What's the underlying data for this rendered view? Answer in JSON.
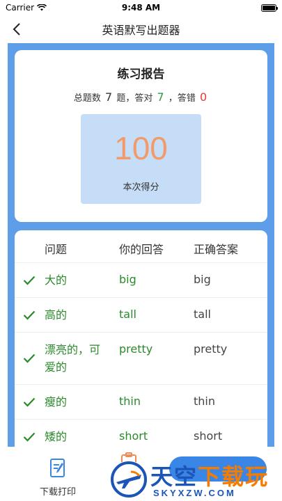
{
  "status_bar": {
    "carrier": "Carrier",
    "time": "9:48 AM"
  },
  "nav": {
    "title": "英语默写出题器"
  },
  "report": {
    "title": "练习报告",
    "total_prefix": "总题数",
    "total_count": "7",
    "total_suffix": "题，答对",
    "correct_count": "7",
    "correct_suffix": "，答错",
    "wrong_count": "0",
    "score": "100",
    "score_label": "本次得分"
  },
  "table": {
    "headers": [
      "问题",
      "你的回答",
      "正确答案"
    ],
    "rows": [
      {
        "question": "大的",
        "answer": "big",
        "correct": "big",
        "status": "correct"
      },
      {
        "question": "高的",
        "answer": "tall",
        "correct": "tall",
        "status": "correct"
      },
      {
        "question": "漂亮的，可爱的",
        "answer": "pretty",
        "correct": "pretty",
        "status": "correct"
      },
      {
        "question": "瘦的",
        "answer": "thin",
        "correct": "thin",
        "status": "correct"
      },
      {
        "question": "矮的",
        "answer": "short",
        "correct": "short",
        "status": "correct"
      }
    ]
  },
  "bottom": {
    "download_label": "下载打印"
  },
  "watermark": {
    "name_part1": "天空",
    "name_part2": "下载玩",
    "url": "SKYXZW.COM"
  },
  "colors": {
    "panel_blue": "#5e9ee8",
    "score_box": "#c6ddf7",
    "score_text": "#f39a6b",
    "correct_green": "#2a9d3f",
    "wrong_red": "#e53935"
  }
}
